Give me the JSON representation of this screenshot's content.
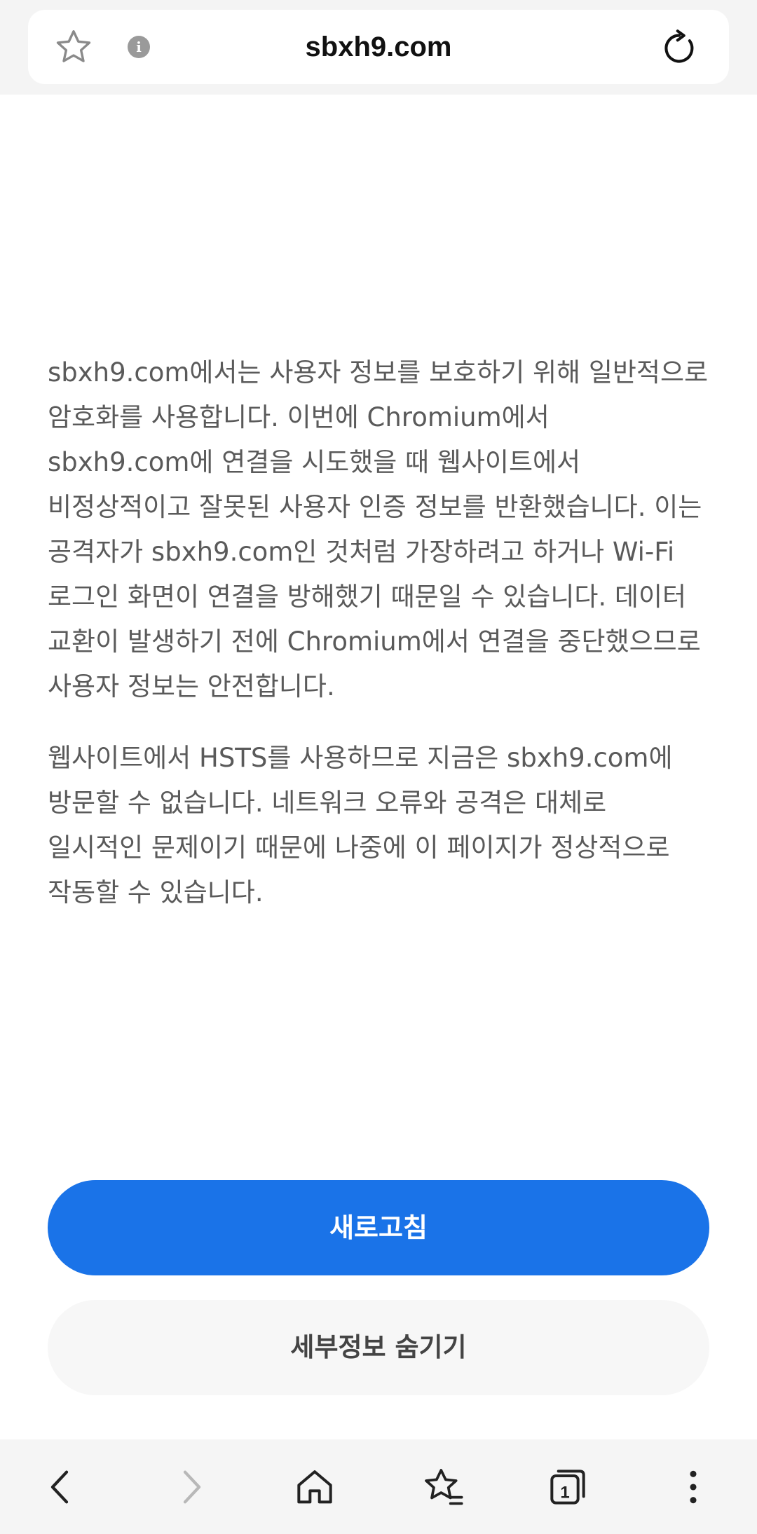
{
  "address_bar": {
    "url": "sbxh9.com",
    "favorite_icon": "star-outline-icon",
    "info_icon": "info-icon",
    "info_glyph": "i",
    "reload_icon": "reload-icon"
  },
  "error_page": {
    "paragraphs": [
      "sbxh9.com에서는 사용자 정보를 보호하기 위해 일반적으로 암호화를 사용합니다. 이번에 Chromium에서 sbxh9.com에 연결을 시도했을 때 웹사이트에서 비정상적이고 잘못된 사용자 인증 정보를 반환했습니다. 이는 공격자가 sbxh9.com인 것처럼 가장하려고 하거나 Wi-Fi 로그인 화면이 연결을 방해했기 때문일 수 있습니다. 데이터 교환이 발생하기 전에 Chromium에서 연결을 중단했으므로 사용자 정보는 안전합니다.",
      "웹사이트에서 HSTS를 사용하므로 지금은 sbxh9.com에 방문할 수 없습니다. 네트워크 오류와 공격은 대체로 일시적인 문제이기 때문에 나중에 이 페이지가 정상적으로 작동할 수 있습니다."
    ],
    "reload_button": "새로고침",
    "hide_details_button": "세부정보 숨기기"
  },
  "bottom_nav": {
    "items": [
      {
        "icon": "back-icon"
      },
      {
        "icon": "forward-icon"
      },
      {
        "icon": "home-icon"
      },
      {
        "icon": "bookmarks-icon"
      },
      {
        "icon": "tabs-icon",
        "count": "1"
      },
      {
        "icon": "more-icon"
      }
    ]
  },
  "colors": {
    "primary": "#1a73e8",
    "text": "#5a5a5a",
    "secondary_button_bg": "#f7f7f7",
    "bar_bg": "#f4f4f4",
    "forward_disabled": "#b8b8b8"
  }
}
